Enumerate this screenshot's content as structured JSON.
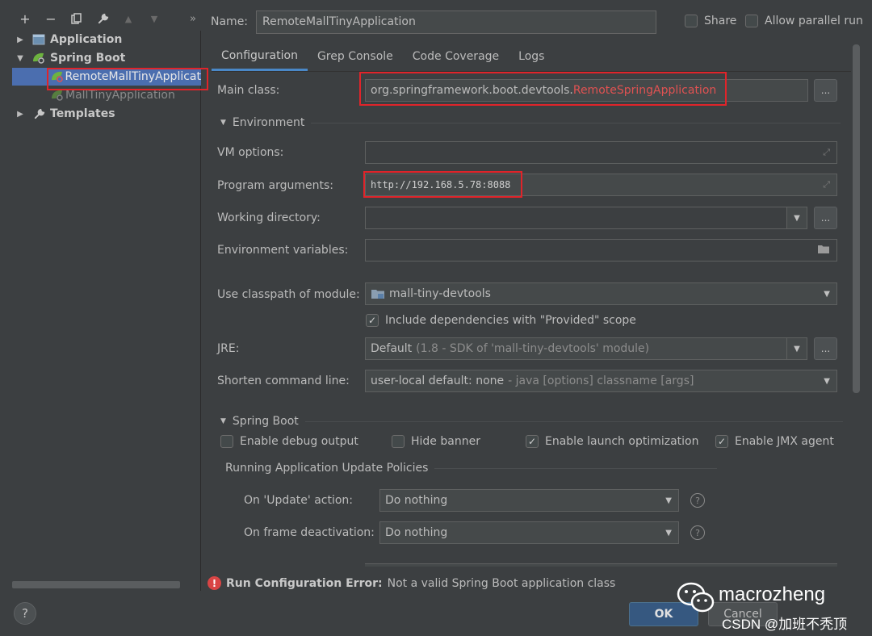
{
  "tree": {
    "items": [
      {
        "label": "Application"
      },
      {
        "label": "Spring Boot"
      },
      {
        "label": "RemoteMallTinyApplicat"
      },
      {
        "label": "MallTinyApplication"
      },
      {
        "label": "Templates"
      }
    ]
  },
  "header": {
    "name_label": "Name:",
    "name_value": "RemoteMallTinyApplication",
    "share_label": "Share",
    "parallel_label": "Allow parallel run"
  },
  "tabs": [
    {
      "label": "Configuration"
    },
    {
      "label": "Grep Console"
    },
    {
      "label": "Code Coverage"
    },
    {
      "label": "Logs"
    }
  ],
  "form": {
    "main_class_label": "Main class:",
    "main_class_prefix": "org.springframework.boot.devtools.",
    "main_class_name": "RemoteSpringApplication",
    "environment_label": "Environment",
    "vm_options_label": "VM options:",
    "program_args_label": "Program arguments:",
    "program_args_value": "http://192.168.5.78:8088",
    "working_dir_label": "Working directory:",
    "env_vars_label": "Environment variables:",
    "classpath_label": "Use classpath of module:",
    "classpath_value": "mall-tiny-devtools",
    "include_deps_label": "Include dependencies with \"Provided\" scope",
    "jre_label": "JRE:",
    "jre_value": "Default",
    "jre_detail": "(1.8 - SDK of 'mall-tiny-devtools' module)",
    "shorten_label": "Shorten command line:",
    "shorten_value": "user-local default: none",
    "shorten_detail": "- java [options] classname [args]",
    "dots": "..."
  },
  "spring_boot": {
    "section_label": "Spring Boot",
    "debug_label": "Enable debug output",
    "hide_banner_label": "Hide banner",
    "launch_opt_label": "Enable launch optimization",
    "jmx_label": "Enable JMX agent",
    "policies_label": "Running Application Update Policies",
    "on_update_label": "On 'Update' action:",
    "on_update_value": "Do nothing",
    "on_frame_label": "On frame deactivation:",
    "on_frame_value": "Do nothing"
  },
  "footer": {
    "error_title": "Run Configuration Error:",
    "error_message": "Not a valid Spring Boot application class",
    "ok_label": "OK",
    "cancel_label": "Cancel",
    "help_label": "?"
  },
  "watermark": {
    "name": "macrozheng",
    "sub": "CSDN @加班不秃顶"
  },
  "colors": {
    "background": "#3c3f41",
    "selection": "#4b6eaf",
    "accent_tab": "#4a88c7",
    "error_red": "#e05252",
    "highlight_box": "#e0242a",
    "ok_button": "#365880"
  }
}
